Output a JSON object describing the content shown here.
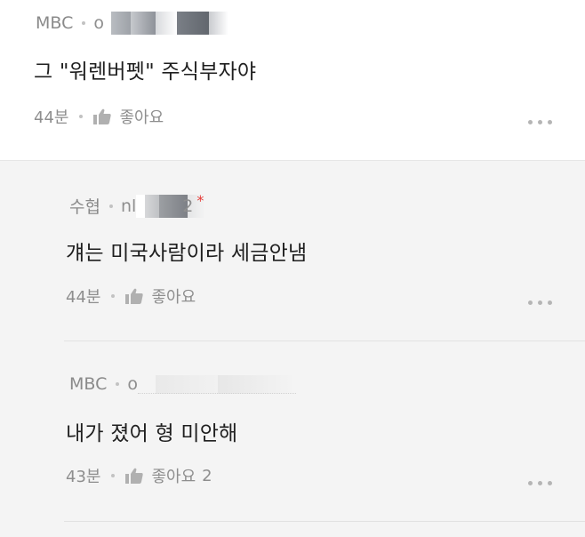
{
  "comments": [
    {
      "author": "MBC",
      "handle_visible": "o",
      "body": "그 \"워렌버펫\" 주식부자야",
      "time": "44분",
      "like_label": "좋아요",
      "like_count": ""
    }
  ],
  "replies": [
    {
      "author": "수협",
      "handle_visible_start": "nl",
      "handle_visible_end": "2",
      "badge": "*",
      "body": "걔는 미국사람이라 세금안냄",
      "time": "44분",
      "like_label": "좋아요",
      "like_count": ""
    },
    {
      "author": "MBC",
      "handle_visible": "o",
      "body": "내가 졌어 형 미안해",
      "time": "43분",
      "like_label": "좋아요",
      "like_count": "2"
    }
  ],
  "icons": {
    "like": "thumbs-up-icon",
    "more": "more-options-icon"
  },
  "colors": {
    "text": "#1f1f1f",
    "meta": "#8e8e8e",
    "reply_background": "#f4f4f4",
    "badge": "#e53935"
  }
}
